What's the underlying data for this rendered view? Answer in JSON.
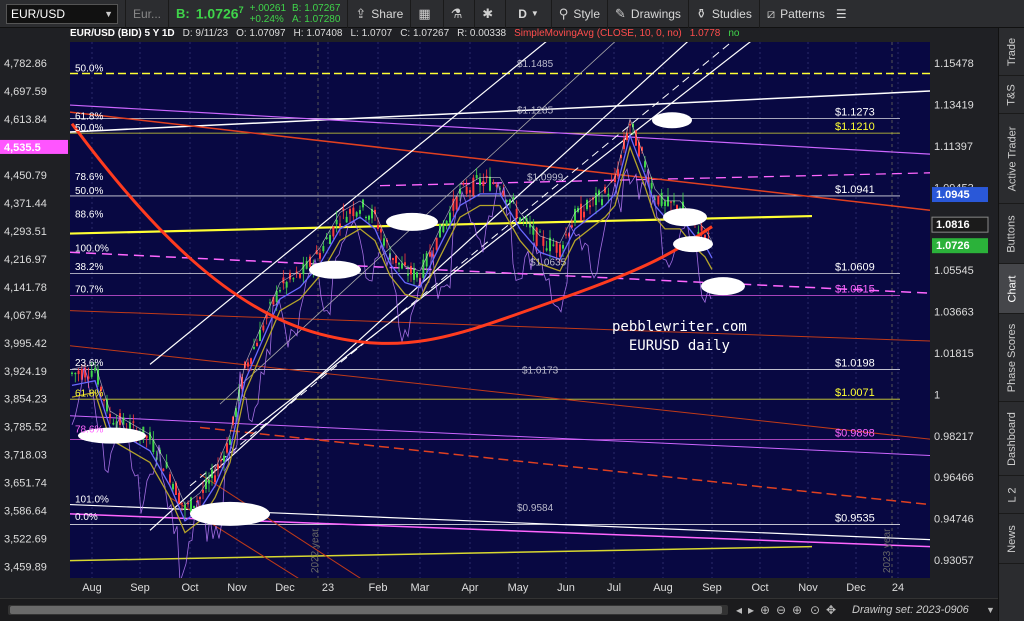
{
  "toolbar": {
    "symbol": "EUR/USD",
    "linked_symbol": "Eur...",
    "last_label": "B:",
    "last": "1.0726",
    "last_sup": "7",
    "change": "+.00261",
    "change_pct": "+0.24%",
    "bid": "B: 1.07267",
    "ask": "A: 1.07280",
    "share": "Share",
    "period": "D",
    "style": "Style",
    "drawings": "Drawings",
    "studies": "Studies",
    "patterns": "Patterns"
  },
  "info": {
    "symbol": "EUR/USD (BID) 5 Y 1D",
    "date": "D: 9/11/23",
    "open": "O: 1.07097",
    "high": "H: 1.07408",
    "low": "L: 1.0707",
    "close": "C: 1.07267",
    "range": "R: 0.00338",
    "sma": "SimpleMovingAvg (CLOSE, 10, 0, no)",
    "sma_val": "1.0778",
    "sma_ok": "no"
  },
  "right_tabs": [
    "Trade",
    "T&S",
    "Active Trader",
    "Buttons",
    "Chart",
    "Phase Scores",
    "Dashboard",
    "L 2",
    "News"
  ],
  "watermark": [
    "pebblewriter.com",
    "EURUSD daily"
  ],
  "drawing_set": "Drawing set: 2023-0906",
  "colors": {
    "bg": "#080842",
    "candle_up": "#3fd44a",
    "candle_down": "#ff3b3b",
    "sma_red": "#ff3b1f",
    "fib_yellow": "#ffff33",
    "pink": "#ff66ff",
    "white": "#ffffff",
    "olive": "#b5a42a",
    "blue_ma": "#6a6aff"
  },
  "chart_data": {
    "type": "line",
    "x": [
      "Aug",
      "Sep",
      "Oct",
      "Nov",
      "Dec",
      "23",
      "Feb",
      "Mar",
      "Apr",
      "May",
      "Jun",
      "Jul",
      "Aug",
      "Sep",
      "Oct",
      "Nov",
      "Dec",
      "24"
    ],
    "series": [
      {
        "values": [
          1.005,
          0.985,
          0.975,
          0.99,
          1.05,
          1.07,
          1.085,
          1.06,
          1.09,
          1.085,
          1.075,
          1.1,
          1.09,
          1.072
        ]
      }
    ],
    "right_axis": [
      "1.15478",
      "1.13419",
      "1.11397",
      "1.09453",
      "1.07487",
      "1.05545",
      "1.03663",
      "1.01815",
      "1",
      "0.98217",
      "0.96466",
      "0.94746",
      "0.93057"
    ],
    "left_axis": [
      "4,782.86",
      "4,697.59",
      "4,613.84",
      "4,535.5",
      "4,450.79",
      "4,371.44",
      "4,293.51",
      "4,216.97",
      "4,141.78",
      "4,067.94",
      "3,995.42",
      "3,924.19",
      "3,854.23",
      "3,785.52",
      "3,718.03",
      "3,651.74",
      "3,586.64",
      "3,522.69",
      "3,459.89"
    ],
    "right_badges": [
      {
        "text": "1.0945",
        "sup": "3",
        "color": "#2a58d8"
      },
      {
        "text": "1.0816",
        "sup": "4",
        "color": "#1b1b1b"
      },
      {
        "text": "1.0726",
        "sup": "7",
        "color": "#2bb23a"
      }
    ],
    "left_badge": "4,535.5",
    "fib_labels": [
      {
        "text": "50.0%",
        "y": 1.1465
      },
      {
        "text": "61.8%",
        "y": 1.126
      },
      {
        "text": "50.0%",
        "y": 1.121
      },
      {
        "text": "78.6%",
        "y": 1.1
      },
      {
        "text": "50.0%",
        "y": 1.094
      },
      {
        "text": "88.6%",
        "y": 1.084
      },
      {
        "text": "100.0%",
        "y": 1.0695
      },
      {
        "text": "38.2%",
        "y": 1.0615
      },
      {
        "text": "70.7%",
        "y": 1.052
      },
      {
        "text": "23.6%",
        "y": 1.0205
      },
      {
        "text": "61.8%",
        "y": 1.0075
      },
      {
        "text": "78.6%",
        "y": 0.992
      },
      {
        "text": "101.0%",
        "y": 0.962
      },
      {
        "text": "0.0%",
        "y": 0.9545
      }
    ],
    "levels": [
      {
        "text": "$1.1273",
        "sup": "4",
        "y": 1.1273,
        "color": "#ffffff"
      },
      {
        "text": "$1.1210",
        "sup": "4",
        "y": 1.121,
        "color": "#ffff33"
      },
      {
        "text": "$1.0941",
        "sup": "5",
        "y": 1.0941,
        "color": "#ffffff"
      },
      {
        "text": "$1.0609",
        "sup": "6",
        "y": 1.0609,
        "color": "#ffffff"
      },
      {
        "text": "$1.0515",
        "sup": "3",
        "y": 1.0515,
        "color": "#ff66ff"
      },
      {
        "text": "$1.0198",
        "sup": "9",
        "y": 1.0198,
        "color": "#ffffff"
      },
      {
        "text": "$1.0071",
        "sup": "3",
        "y": 1.0071,
        "color": "#ffff33"
      },
      {
        "text": "$0.9898",
        "sup": "3",
        "y": 0.9898,
        "color": "#ff66ff"
      },
      {
        "text": "$0.9535",
        "sup": "",
        "y": 0.9535,
        "color": "#ffffff"
      }
    ],
    "mid_labels": [
      {
        "text": "$1.1485",
        "sup": "5",
        "y": 1.1485
      },
      {
        "text": "$1.1285",
        "sup": "1",
        "y": 1.1285
      },
      {
        "text": "$1.0999",
        "sup": "",
        "y": 1.0999
      },
      {
        "text": "$1.0635",
        "sup": "",
        "y": 1.0635
      },
      {
        "text": "$1.0173",
        "sup": "",
        "y": 1.0173
      },
      {
        "text": "$0.9584",
        "sup": "6",
        "y": 0.9584
      }
    ],
    "year_labels": [
      "2022 year",
      "2023 year"
    ],
    "ylim": [
      0.93057,
      1.16
    ]
  }
}
